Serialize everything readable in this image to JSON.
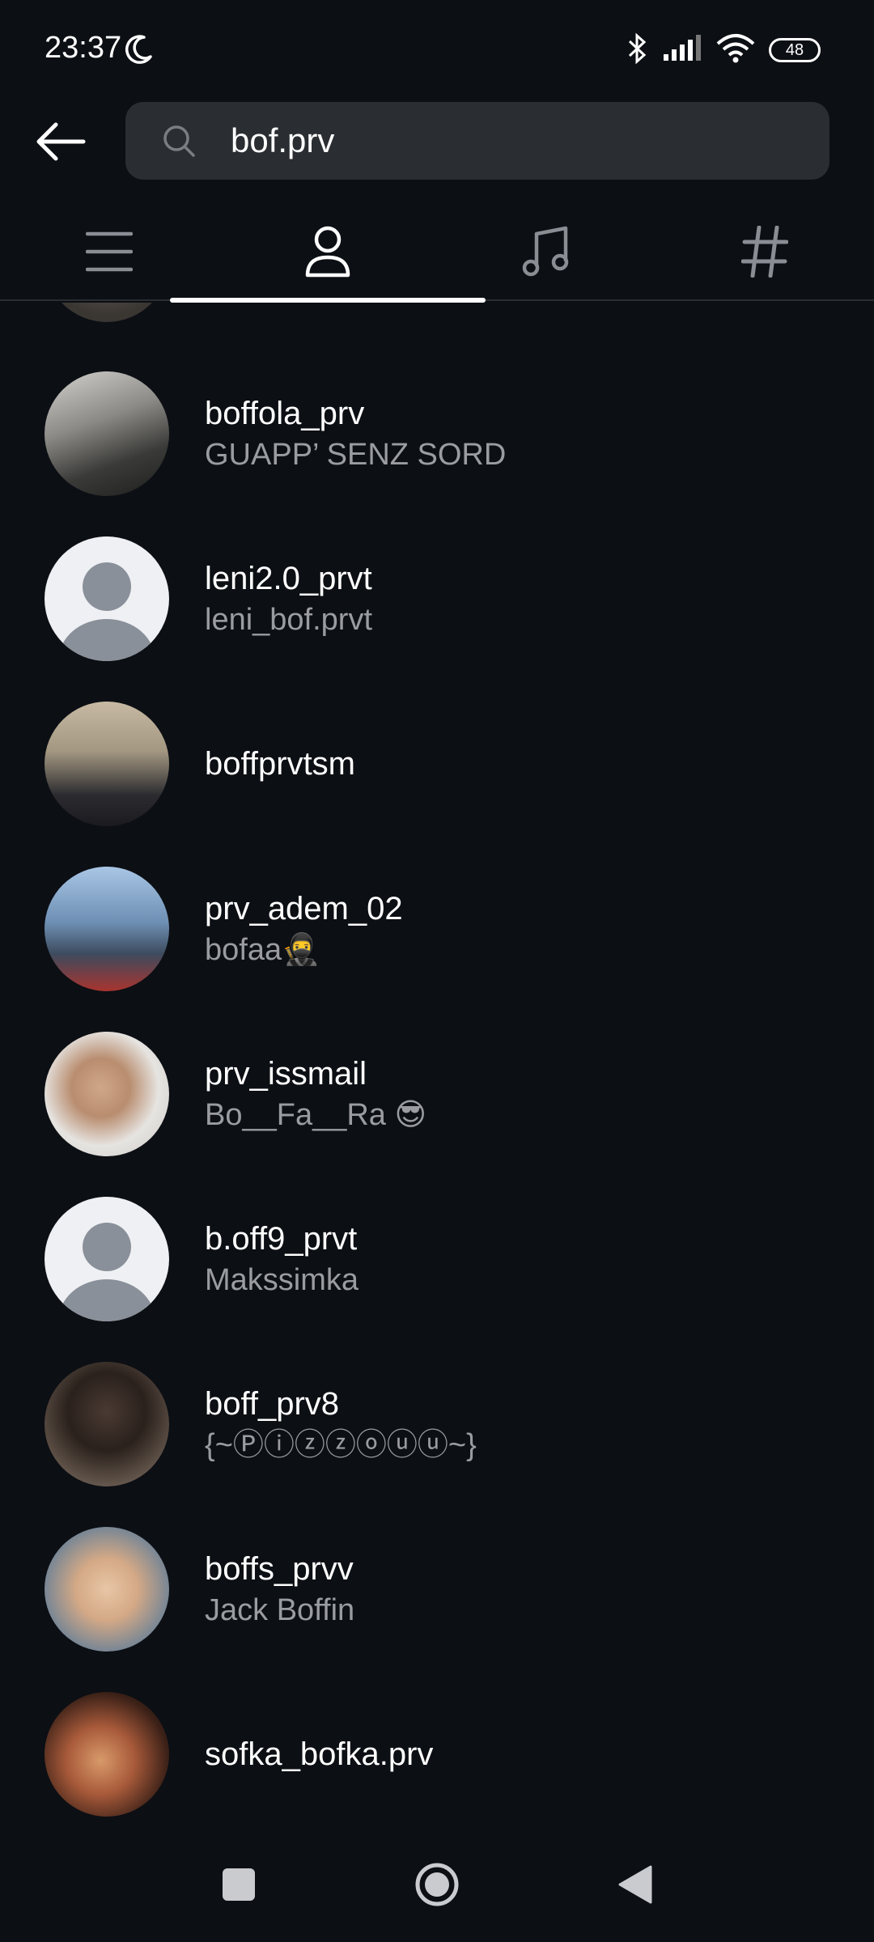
{
  "status_bar": {
    "time": "23:37",
    "battery": "48",
    "icons": [
      "moon-icon",
      "bluetooth-icon",
      "signal-icon",
      "wifi-icon",
      "battery-icon"
    ]
  },
  "search": {
    "query": "bof.prv",
    "icon": "search-icon"
  },
  "tabs": [
    {
      "icon": "list-icon",
      "active": false
    },
    {
      "icon": "person-icon",
      "active": true
    },
    {
      "icon": "music-note-icon",
      "active": false
    },
    {
      "icon": "hashtag-icon",
      "active": false
    }
  ],
  "results": [
    {
      "username": "boffola_prv",
      "full_name": "GUAPP’ SENZ SORD",
      "avatar": "photo"
    },
    {
      "username": "leni2.0_prvt",
      "full_name": "leni_bof.prvt",
      "avatar": "default"
    },
    {
      "username": "boffprvtsm",
      "full_name": "",
      "avatar": "photo"
    },
    {
      "username": "prv_adem_02",
      "full_name": "bofaa🥷",
      "avatar": "photo"
    },
    {
      "username": "prv_issmail",
      "full_name": "Bo__Fa__Ra 😎",
      "avatar": "photo"
    },
    {
      "username": "b.off9_prvt",
      "full_name": "Makssimka",
      "avatar": "default"
    },
    {
      "username": "boff_prv8",
      "full_name": "{~Ⓟⓘⓩⓩⓞⓤⓤ~}",
      "avatar": "photo"
    },
    {
      "username": "boffs_prvv",
      "full_name": "Jack Boffin",
      "avatar": "photo"
    },
    {
      "username": "sofka_bofka.prv",
      "full_name": "",
      "avatar": "photo"
    }
  ],
  "nav": [
    "recents-square-icon",
    "home-circle-icon",
    "back-triangle-icon"
  ],
  "colors": {
    "background": "#0c0f14",
    "search_field": "#2a2d32",
    "secondary_text": "#9a9ca1",
    "tab_indicator": "#ffffff"
  }
}
